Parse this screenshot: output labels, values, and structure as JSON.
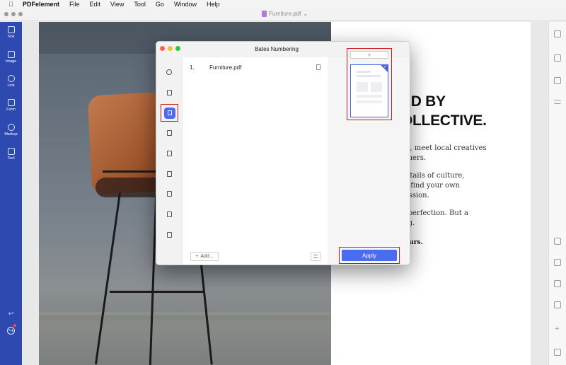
{
  "menubar": {
    "apple": "",
    "items": [
      "PDFelement",
      "File",
      "Edit",
      "View",
      "Tool",
      "Go",
      "Window",
      "Help"
    ]
  },
  "window": {
    "title": "Furniture.pdf"
  },
  "left_sidebar": {
    "items": [
      {
        "label": "Text",
        "icon": "pen-icon"
      },
      {
        "label": "Image",
        "icon": "image-icon"
      },
      {
        "label": "Link",
        "icon": "link-icon"
      },
      {
        "label": "Form",
        "icon": "form-icon"
      },
      {
        "label": "Markup",
        "icon": "markup-icon"
      },
      {
        "label": "Tool",
        "icon": "toolbox-icon"
      }
    ],
    "undo": "↩",
    "redo": "↪"
  },
  "document": {
    "heading_line1": "ED BY",
    "heading_line2": "OLLECTIVE.",
    "paragraph_lines": [
      "na, meet local creatives",
      "igners.",
      "details of culture,",
      "to find your own",
      "ression.",
      "n perfection. But a",
      "ing."
    ],
    "bold_line": "yours."
  },
  "dialog": {
    "title": "Bates Numbering",
    "files": [
      {
        "index": "1.",
        "name": "Furniture.pdf"
      }
    ],
    "add_label": "Add...",
    "template_add_label": "+",
    "apply_label": "Apply"
  },
  "colors": {
    "sidebar": "#2e4ab0",
    "accent": "#4b6bf0",
    "highlight_box": "#d21a1a"
  }
}
